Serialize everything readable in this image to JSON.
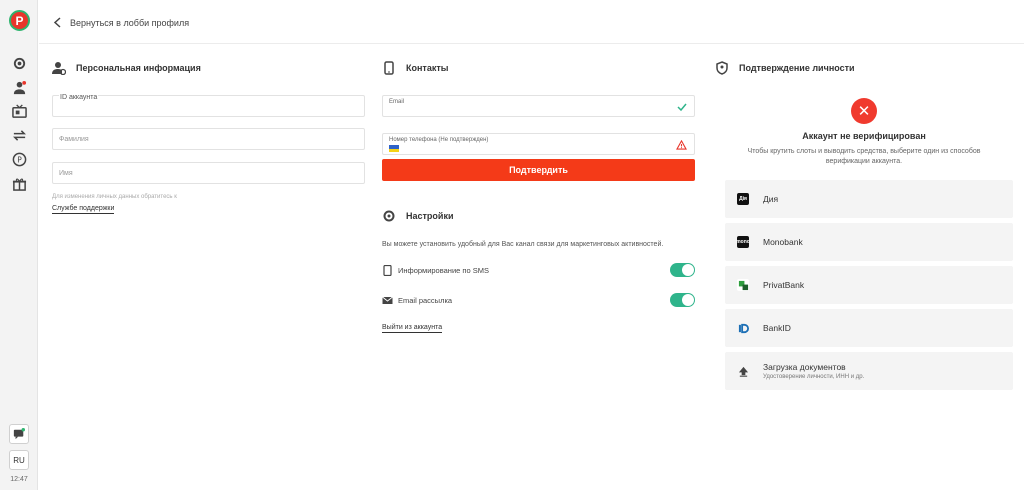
{
  "sidebar": {
    "lang": "RU",
    "time": "12:47"
  },
  "topbar": {
    "back_label": "Вернуться в лобби профиля"
  },
  "personal": {
    "title": "Персональная информация",
    "id_label": "ID аккаунта",
    "surname_placeholder": "Фамилия",
    "name_placeholder": "Имя",
    "note": "Для изменения личных данных обратитесь к",
    "support_link": "Службе поддержки"
  },
  "contacts": {
    "title": "Контакты",
    "email_label": "Email",
    "phone_label": "Номер телефона (Не подтвержден)",
    "confirm_button": "Подтвердить"
  },
  "settings": {
    "title": "Настройки",
    "description": "Вы можете установить удобный для Вас канал связи для маркетинговых активностей.",
    "sms_label": "Информирование по SMS",
    "sms_on": true,
    "email_label": "Email рассылка",
    "email_on": true,
    "logout_link": "Выйти из аккаунта"
  },
  "verification": {
    "title": "Подтверждение личности",
    "status_title": "Аккаунт не верифицирован",
    "status_sub": "Чтобы крутить слоты и выводить средства, выберите один из способов верификации аккаунта.",
    "methods": [
      {
        "name": "Дия",
        "icon": "diia-icon",
        "icon_text": "Дія"
      },
      {
        "name": "Monobank",
        "icon": "monobank-icon",
        "icon_text": "mono"
      },
      {
        "name": "PrivatBank",
        "icon": "privatbank-icon"
      },
      {
        "name": "BankID",
        "icon": "bankid-icon"
      },
      {
        "name": "Загрузка документов",
        "sub": "Удостоверение личности, ИНН и др.",
        "icon": "upload-icon"
      }
    ]
  },
  "colors": {
    "accent": "#f43a18",
    "toggle": "#2fb48b",
    "success": "#2fb48b",
    "warning": "#e8352b"
  }
}
